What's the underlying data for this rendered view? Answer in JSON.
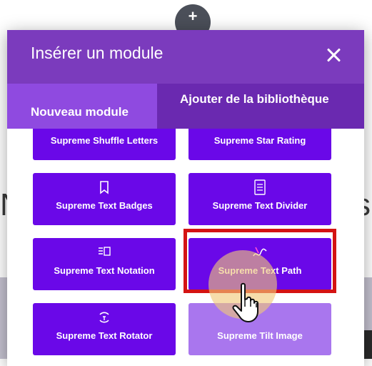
{
  "background": {
    "left_text": "N",
    "right_text": "s",
    "top_button_label": "+"
  },
  "modal": {
    "title": "Insérer un module",
    "close_icon": "close-icon",
    "tabs": [
      {
        "label": "Nouveau module",
        "active": true
      },
      {
        "label": "Ajouter de la bibliothèque",
        "active": false
      }
    ],
    "modules": [
      {
        "label": "Supreme Shuffle Letters",
        "icon": "shuffle-letters-icon"
      },
      {
        "label": "Supreme Star Rating",
        "icon": "star-rating-icon"
      },
      {
        "label": "Supreme Text Badges",
        "icon": "text-badges-icon"
      },
      {
        "label": "Supreme Text Divider",
        "icon": "text-divider-icon"
      },
      {
        "label": "Supreme Text Notation",
        "icon": "text-notation-icon"
      },
      {
        "label": "Supreme Text Path",
        "icon": "text-path-icon",
        "highlighted": true
      },
      {
        "label": "Supreme Text Rotator",
        "icon": "text-rotator-icon"
      },
      {
        "label": "Supreme Tilt Image",
        "icon": "tilt-image-icon"
      }
    ]
  },
  "colors": {
    "header": "#7b3bbd",
    "tab_bar": "#6a29b0",
    "tab_active": "#8f4ae0",
    "module_bg": "#6a08e8",
    "module_light_bg": "#a976ee",
    "highlight_border": "#d41313"
  }
}
